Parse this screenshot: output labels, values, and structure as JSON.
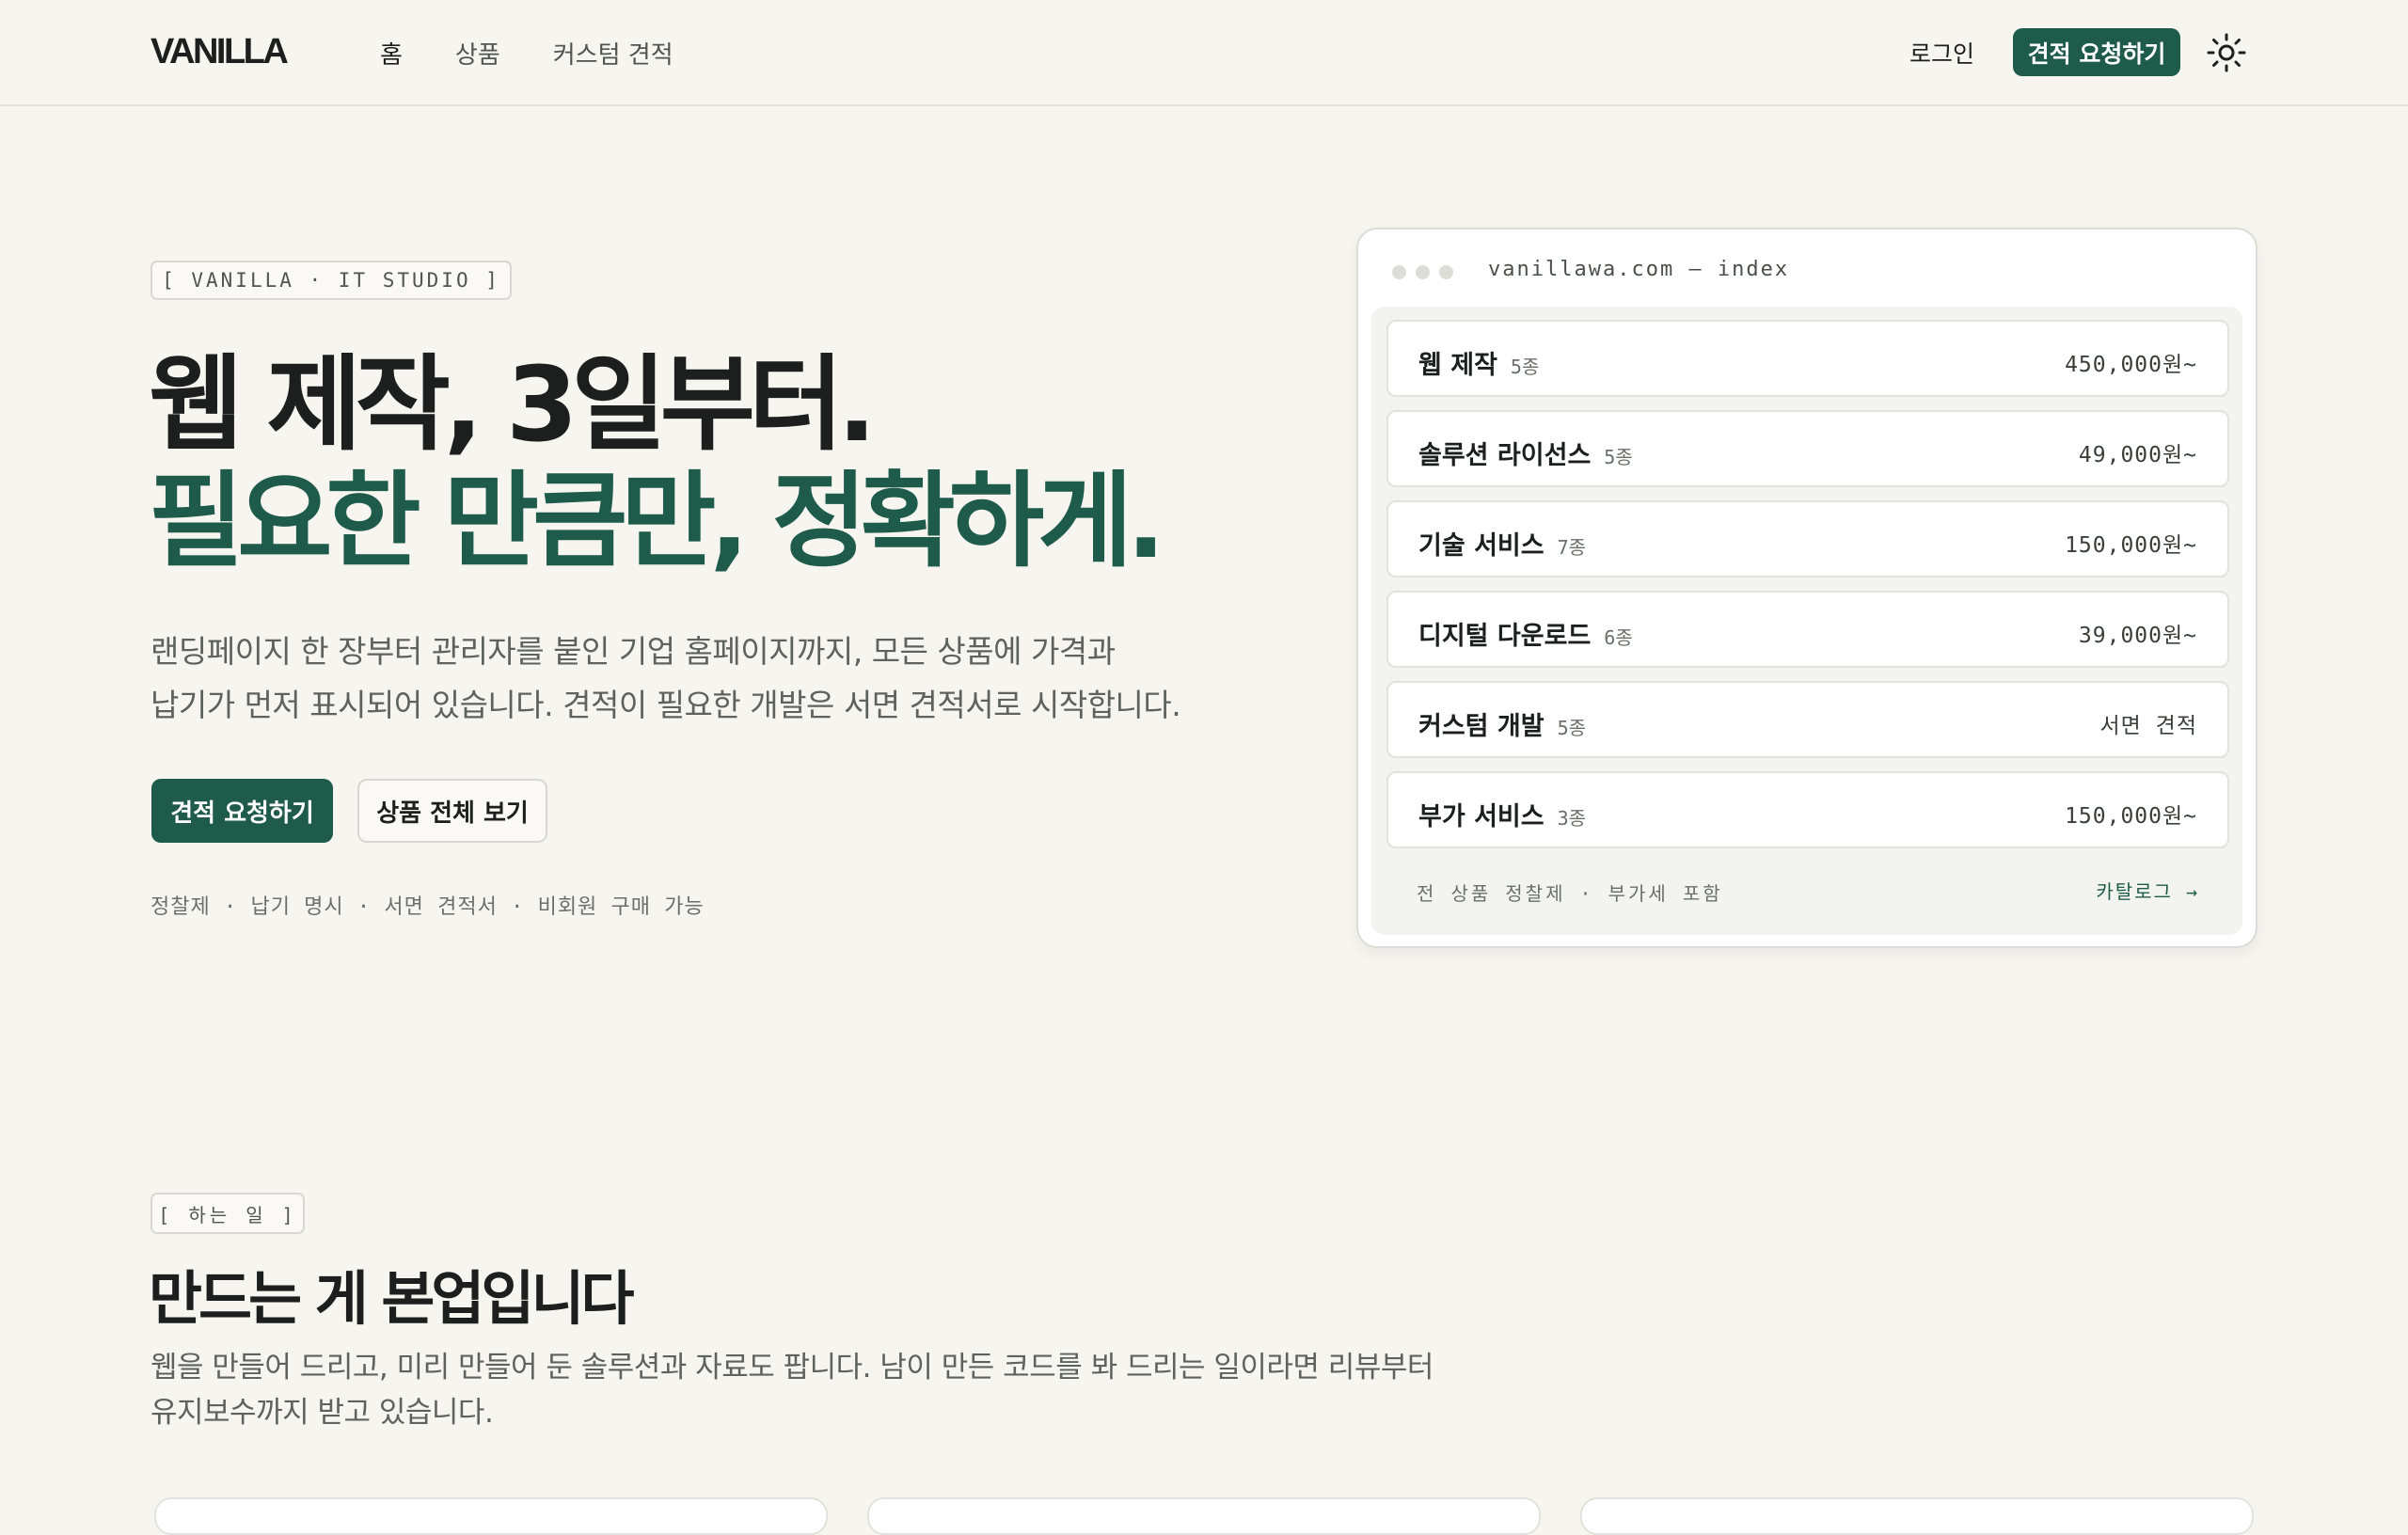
{
  "header": {
    "logo": "VANILLA",
    "nav": [
      "홈",
      "상품",
      "커스텀 견적"
    ],
    "login": "로그인",
    "cta": "견적 요청하기",
    "theme_icon": "sun-icon"
  },
  "hero": {
    "tag": "[ VANILLA · IT STUDIO ]",
    "title_line1": "웹 제작, 3일부터.",
    "title_line2": "필요한 만큼만, 정확하게.",
    "desc_line1": "랜딩페이지 한 장부터 관리자를 붙인 기업 홈페이지까지, 모든 상품에 가격과",
    "desc_line2": "납기가 먼저 표시되어 있습니다. 견적이 필요한 개발은 서면 견적서로 시작합니다.",
    "primary_button": "견적 요청하기",
    "secondary_button": "상품 전체 보기",
    "meta": "정찰제 · 납기 명시 · 서면 견적서 · 비회원 구매 가능"
  },
  "mock": {
    "url": "vanillawa.com — index",
    "rows": [
      {
        "name": "웹 제작",
        "count": "5종",
        "price": "450,000원~"
      },
      {
        "name": "솔루션 라이선스",
        "count": "5종",
        "price": "49,000원~"
      },
      {
        "name": "기술 서비스",
        "count": "7종",
        "price": "150,000원~"
      },
      {
        "name": "디지털 다운로드",
        "count": "6종",
        "price": "39,000원~"
      },
      {
        "name": "커스텀 개발",
        "count": "5종",
        "price": "서면 견적"
      },
      {
        "name": "부가 서비스",
        "count": "3종",
        "price": "150,000원~"
      }
    ],
    "footer_note": "전 상품 정찰제 · 부가세 포함",
    "catalog_link": "카탈로그 →"
  },
  "section": {
    "tag": "[ 하는 일 ]",
    "title": "만드는 게 본업입니다",
    "desc_line1": "웹을 만들어 드리고, 미리 만들어 둔 솔루션과 자료도 팝니다. 남이 만든 코드를 봐 드리는 일이라면 리뷰부터",
    "desc_line2": "유지보수까지 받고 있습니다."
  },
  "colors": {
    "accent": "#1f5b4a",
    "background": "#f6f5f0",
    "text": "#1c1f1d"
  }
}
